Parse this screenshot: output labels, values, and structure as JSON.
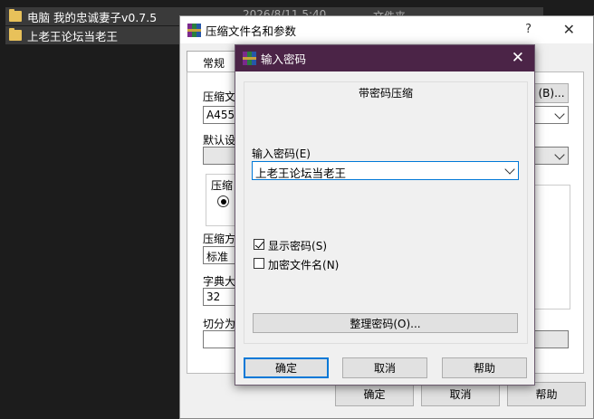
{
  "explorer": {
    "rows": [
      {
        "name": "电脑 我的忠诚妻子v0.7.5",
        "date": "2026/8/11 5:40",
        "type": "文件夹"
      },
      {
        "name": "上老王论坛当老王"
      }
    ]
  },
  "back_dialog": {
    "title": "压缩文件名和参数",
    "help": "?",
    "close": "✕",
    "tab_general": "常规",
    "archive_name_label": "压缩文",
    "archive_name_value": "A4556",
    "browse_button": "(B)...",
    "default_label": "默认设",
    "archive_format_label": "压缩",
    "method_label": "压缩方",
    "method_value": "标准",
    "dict_label": "字典大",
    "dict_value": "32",
    "split_label": "切分为",
    "ok": "确定",
    "cancel": "取消",
    "help_button": "帮助"
  },
  "password_dialog": {
    "title": "输入密码",
    "close": "✕",
    "heading": "带密码压缩",
    "password_label": "输入密码",
    "password_hotkey": "(E)",
    "password_value": "上老王论坛当老王",
    "show_password_label": "显示密码",
    "show_password_hotkey": "(S)",
    "show_password_checked": true,
    "encrypt_names_label": "加密文件名",
    "encrypt_names_hotkey": "(N)",
    "encrypt_names_checked": false,
    "organize_button": "整理密码(O)...",
    "ok": "确定",
    "cancel": "取消",
    "help": "帮助"
  }
}
